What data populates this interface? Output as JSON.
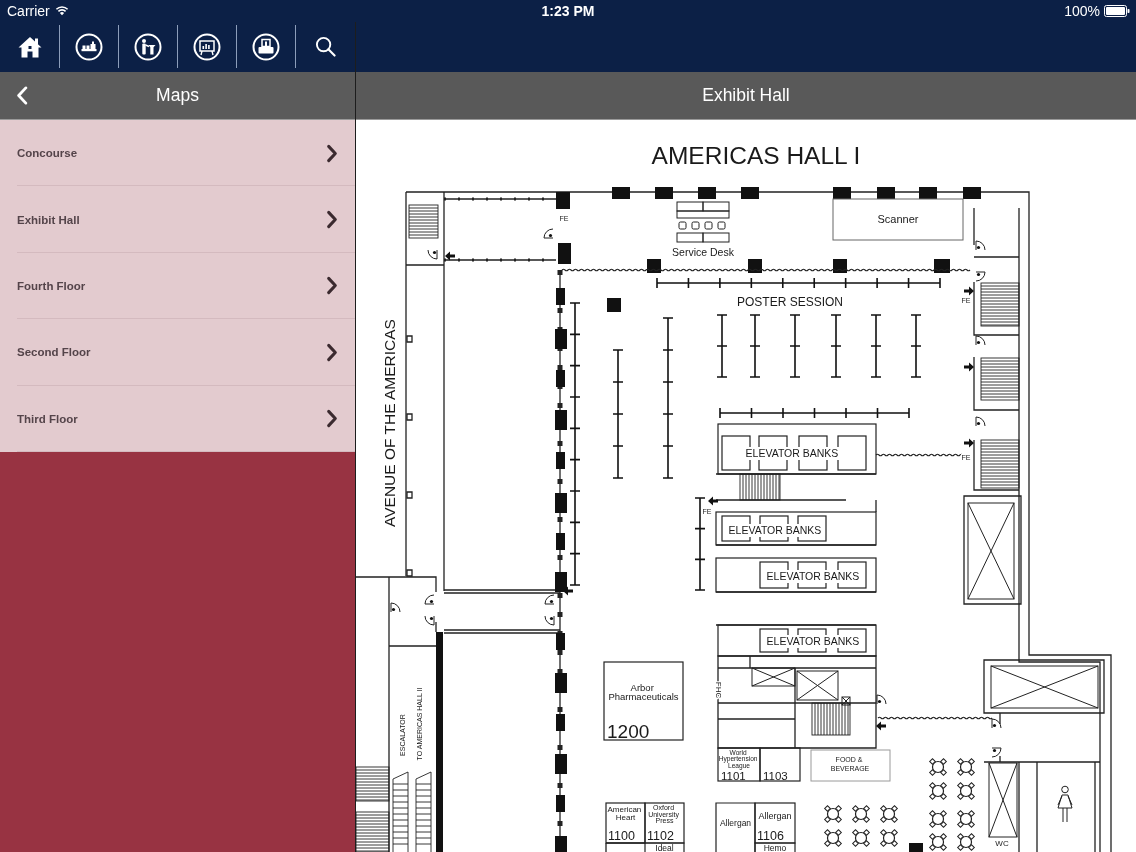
{
  "status_bar": {
    "carrier": "Carrier",
    "time": "1:23 PM",
    "battery": "100%"
  },
  "sidebar": {
    "title": "Maps",
    "items": [
      {
        "label": "Concourse"
      },
      {
        "label": "Exhibit Hall"
      },
      {
        "label": "Fourth Floor"
      },
      {
        "label": "Second Floor"
      },
      {
        "label": "Third Floor"
      }
    ]
  },
  "detail": {
    "title": "Exhibit Hall"
  },
  "floor_plan": {
    "title": "AMERICAS HALL I",
    "street": "AVENUE OF THE AMERICAS",
    "areas": [
      {
        "name": "Service Desk"
      },
      {
        "name": "Scanner"
      },
      {
        "name": "POSTER SESSION"
      },
      {
        "name": "FOOD & BEVERAGE"
      }
    ],
    "elevator_banks": [
      "ELEVATOR BANKS",
      "ELEVATOR BANKS",
      "ELEVATOR BANKS",
      "ELEVATOR BANKS"
    ],
    "booths": [
      {
        "exhibitor": "Arbor Pharmaceuticals",
        "number": "1200"
      },
      {
        "exhibitor": "World Hypertension League",
        "number": "1101"
      },
      {
        "number": "1103"
      },
      {
        "exhibitor": "American Heart",
        "number": "1100"
      },
      {
        "exhibitor": "Oxford University Press",
        "number": "1102"
      },
      {
        "exhibitor": "Allergan"
      },
      {
        "exhibitor": "Allergan",
        "number": "1106"
      },
      {
        "exhibitor": "Hemo"
      },
      {
        "exhibitor": "Ideal"
      }
    ],
    "signs": [
      {
        "text": "FE"
      },
      {
        "text": "FE"
      },
      {
        "text": "FE"
      },
      {
        "text": "FE"
      },
      {
        "text": "FHC"
      },
      {
        "text": "WC"
      },
      {
        "text": "ESCALATOR"
      },
      {
        "text": "TO AMERICAS HALL II"
      }
    ]
  }
}
